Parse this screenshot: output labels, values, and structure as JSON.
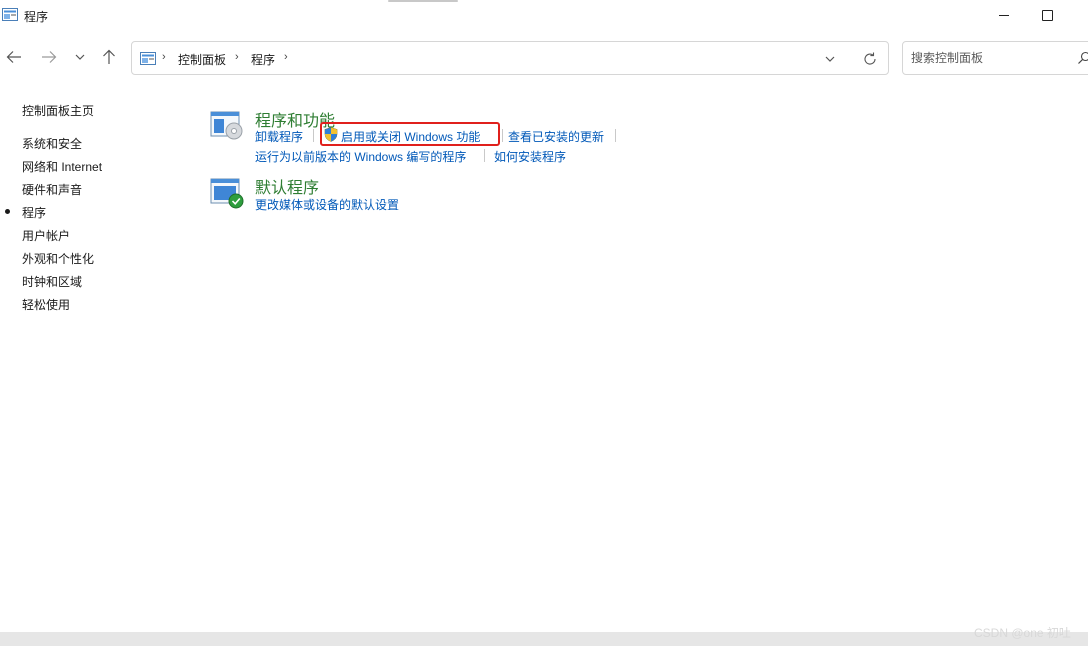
{
  "window": {
    "title": "程序"
  },
  "navigation": {
    "back_icon": "arrow-left-icon",
    "forward_icon": "arrow-right-icon",
    "recent_icon": "chevron-down-icon",
    "up_icon": "arrow-up-icon"
  },
  "address_bar": {
    "crumbs": [
      "控制面板",
      "程序"
    ],
    "separator": "›"
  },
  "search": {
    "placeholder": "搜索控制面板"
  },
  "sidebar": {
    "home_label": "控制面板主页",
    "items": [
      {
        "label": "系统和安全",
        "active": false
      },
      {
        "label": "网络和 Internet",
        "active": false
      },
      {
        "label": "硬件和声音",
        "active": false
      },
      {
        "label": "程序",
        "active": true
      },
      {
        "label": "用户帐户",
        "active": false
      },
      {
        "label": "外观和个性化",
        "active": false
      },
      {
        "label": "时钟和区域",
        "active": false
      },
      {
        "label": "轻松使用",
        "active": false
      }
    ]
  },
  "categories": [
    {
      "title": "程序和功能",
      "icon": "programs-and-features-icon",
      "links": [
        "卸载程序",
        "启用或关闭 Windows 功能",
        "查看已安装的更新",
        "运行为以前版本的 Windows 编写的程序",
        "如何安装程序"
      ]
    },
    {
      "title": "默认程序",
      "icon": "default-programs-icon",
      "links": [
        "更改媒体或设备的默认设置"
      ]
    }
  ],
  "watermark": "CSDN @one 初吐",
  "colors": {
    "link": "#0058b8",
    "category_title": "#2e7d32",
    "highlight": "#e0201c"
  }
}
